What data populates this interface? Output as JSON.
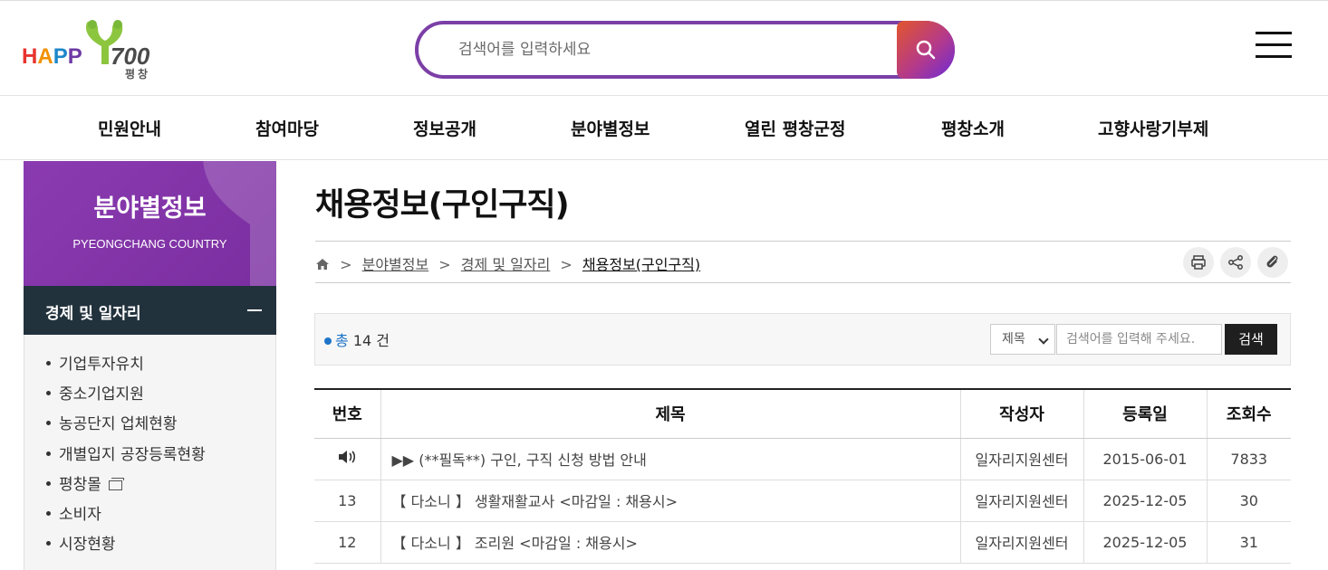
{
  "brand": {
    "logo_word": "HAPP",
    "logo_number": "700",
    "logo_sub": "평창"
  },
  "header": {
    "search_placeholder": "검색어를 입력하세요"
  },
  "gnb": [
    "민원안내",
    "참여마당",
    "정보공개",
    "분야별정보",
    "열린 평창군정",
    "평창소개",
    "고향사랑기부제"
  ],
  "sidebar": {
    "title": "분야별정보",
    "subtitle": "PYEONGCHANG COUNTRY",
    "section": "경제 및 일자리",
    "items": [
      "기업투자유치",
      "중소기업지원",
      "농공단지 업체현황",
      "개별입지 공장등록현황",
      "평창몰",
      "소비자",
      "시장현황"
    ]
  },
  "main": {
    "title": "채용정보(구인구직)",
    "breadcrumb": [
      "분야별정보",
      "경제 및 일자리",
      "채용정보(구인구직)"
    ],
    "total_label": "총",
    "total_count": "14",
    "total_unit": "건",
    "search_field": "제목",
    "search_placeholder": "검색어를 입력해 주세요.",
    "search_button": "검색"
  },
  "table": {
    "headers": [
      "번호",
      "제목",
      "작성자",
      "등록일",
      "조회수"
    ],
    "rows": [
      {
        "no": "",
        "title": "▶▶ (**필독**) 구인, 구직 신청 방법 안내",
        "writer": "일자리지원센터",
        "date": "2015-06-01",
        "views": "7833"
      },
      {
        "no": "13",
        "title": "【 다소니 】 생활재활교사 <마감일 : 채용시>",
        "writer": "일자리지원센터",
        "date": "2025-12-05",
        "views": "30"
      },
      {
        "no": "12",
        "title": "【 다소니 】 조리원 <마감일 : 채용시>",
        "writer": "일자리지원센터",
        "date": "2025-12-05",
        "views": "31"
      }
    ]
  },
  "colors": {
    "accent": "#7b3fa6",
    "sidebar_dark": "#22323d",
    "link_blue": "#1f74c8"
  }
}
